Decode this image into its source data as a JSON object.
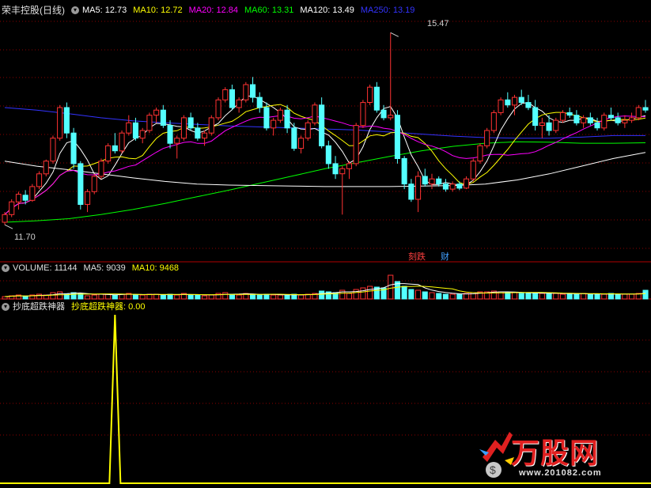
{
  "price_panel": {
    "stock_name": "荣丰控股(日线)",
    "ma_labels": [
      {
        "text": "MA5: 12.73",
        "color": "#ffffff"
      },
      {
        "text": "MA10: 12.72",
        "color": "#ffff00"
      },
      {
        "text": "MA20: 12.84",
        "color": "#ff00ff"
      },
      {
        "text": "MA60: 13.31",
        "color": "#00ff00"
      },
      {
        "text": "MA120: 13.49",
        "color": "#ffffff"
      },
      {
        "text": "MA250: 13.19",
        "color": "#3333ff"
      }
    ],
    "high_label": "15.47",
    "low_label": "11.70",
    "event_tags": [
      {
        "text": "刻跌",
        "color": "#ff4040"
      },
      {
        "text": "财",
        "color": "#40a0ff"
      }
    ]
  },
  "volume_panel": {
    "title": "VOLUME: 11144",
    "ma5": "MA5: 9039",
    "ma10": "MA10: 9468"
  },
  "indicator_panel": {
    "name": "抄底超跌神器",
    "value_label": "抄底超跌神器: 0.00"
  },
  "watermark": {
    "brand": "万股网",
    "url": "www.201082.com"
  },
  "colors": {
    "up": "#ff3232",
    "down": "#54ffff",
    "grid": "#8b0000",
    "ma5": "#ffffff",
    "ma10": "#ffff00",
    "ma20": "#ff00ff",
    "ma60": "#00ff00",
    "ma120": "#ffffff",
    "ma250": "#3333ff",
    "indicator": "#ffff00"
  },
  "chart_data": [
    {
      "type": "candlestick",
      "title": "荣丰控股(日线)",
      "y_range": [
        11.3,
        15.8
      ],
      "annotations": {
        "max": 15.47,
        "min": 11.7
      },
      "candles": [
        [
          11.75,
          11.95,
          11.7,
          11.9
        ],
        [
          11.9,
          12.2,
          11.85,
          12.15
        ],
        [
          12.15,
          12.35,
          12.0,
          12.3
        ],
        [
          12.28,
          12.38,
          12.1,
          12.18
        ],
        [
          12.18,
          12.5,
          12.15,
          12.45
        ],
        [
          12.45,
          12.75,
          12.4,
          12.7
        ],
        [
          12.7,
          12.98,
          12.65,
          12.95
        ],
        [
          12.95,
          13.45,
          12.9,
          13.4
        ],
        [
          13.4,
          14.05,
          13.35,
          14.0
        ],
        [
          14.0,
          14.1,
          13.4,
          13.5
        ],
        [
          13.5,
          13.6,
          12.8,
          12.9
        ],
        [
          12.9,
          12.95,
          12.0,
          12.1
        ],
        [
          12.1,
          12.4,
          11.95,
          12.35
        ],
        [
          12.35,
          12.7,
          12.3,
          12.65
        ],
        [
          12.65,
          13.0,
          12.6,
          12.95
        ],
        [
          12.95,
          13.3,
          12.9,
          13.25
        ],
        [
          13.25,
          13.5,
          13.1,
          13.15
        ],
        [
          13.15,
          13.55,
          13.1,
          13.5
        ],
        [
          13.5,
          13.85,
          13.45,
          13.7
        ],
        [
          13.7,
          13.8,
          13.35,
          13.4
        ],
        [
          13.4,
          13.6,
          13.3,
          13.55
        ],
        [
          13.55,
          13.9,
          13.5,
          13.85
        ],
        [
          13.85,
          14.0,
          13.7,
          13.95
        ],
        [
          13.95,
          14.05,
          13.6,
          13.65
        ],
        [
          13.65,
          13.75,
          13.2,
          13.3
        ],
        [
          13.3,
          13.45,
          13.0,
          13.4
        ],
        [
          13.4,
          13.85,
          13.35,
          13.8
        ],
        [
          13.8,
          13.9,
          13.55,
          13.6
        ],
        [
          13.6,
          13.7,
          13.35,
          13.4
        ],
        [
          13.4,
          13.55,
          13.25,
          13.5
        ],
        [
          13.5,
          13.85,
          13.45,
          13.8
        ],
        [
          13.8,
          14.2,
          13.75,
          14.15
        ],
        [
          14.15,
          14.4,
          14.1,
          14.35
        ],
        [
          14.35,
          14.45,
          13.95,
          14.0
        ],
        [
          14.0,
          14.2,
          13.9,
          14.15
        ],
        [
          14.15,
          14.5,
          14.1,
          14.45
        ],
        [
          14.45,
          14.6,
          14.1,
          14.2
        ],
        [
          14.2,
          14.3,
          13.9,
          14.0
        ],
        [
          14.0,
          14.1,
          13.55,
          13.6
        ],
        [
          13.6,
          13.8,
          13.45,
          13.75
        ],
        [
          13.75,
          14.0,
          13.7,
          13.95
        ],
        [
          13.95,
          14.05,
          13.5,
          13.6
        ],
        [
          13.6,
          13.7,
          13.15,
          13.2
        ],
        [
          13.2,
          13.45,
          13.1,
          13.4
        ],
        [
          13.4,
          13.75,
          13.35,
          13.7
        ],
        [
          13.7,
          14.1,
          13.65,
          14.05
        ],
        [
          14.05,
          14.2,
          13.2,
          13.25
        ],
        [
          13.25,
          13.35,
          12.8,
          12.9
        ],
        [
          12.9,
          13.05,
          12.6,
          12.7
        ],
        [
          12.7,
          12.85,
          11.9,
          12.8
        ],
        [
          12.8,
          12.95,
          12.6,
          12.9
        ],
        [
          12.9,
          13.7,
          12.85,
          13.65
        ],
        [
          13.65,
          14.15,
          13.6,
          14.1
        ],
        [
          14.1,
          14.45,
          14.05,
          14.4
        ],
        [
          14.4,
          14.5,
          13.9,
          13.95
        ],
        [
          13.95,
          14.05,
          13.75,
          13.8
        ],
        [
          13.8,
          15.47,
          13.75,
          13.85
        ],
        [
          13.85,
          13.95,
          12.9,
          13.0
        ],
        [
          13.0,
          13.05,
          12.4,
          12.5
        ],
        [
          12.5,
          12.6,
          12.15,
          12.2
        ],
        [
          12.2,
          12.75,
          11.95,
          12.65
        ],
        [
          12.65,
          12.8,
          12.45,
          12.5
        ],
        [
          12.5,
          12.7,
          12.4,
          12.6
        ],
        [
          12.6,
          12.65,
          12.45,
          12.5
        ],
        [
          12.5,
          12.6,
          12.35,
          12.4
        ],
        [
          12.4,
          12.55,
          12.35,
          12.5
        ],
        [
          12.5,
          12.55,
          12.38,
          12.42
        ],
        [
          12.42,
          12.65,
          12.4,
          12.6
        ],
        [
          12.6,
          13.0,
          12.55,
          12.95
        ],
        [
          12.95,
          13.3,
          12.9,
          13.25
        ],
        [
          13.25,
          13.6,
          13.2,
          13.55
        ],
        [
          13.55,
          13.95,
          13.5,
          13.9
        ],
        [
          13.9,
          14.2,
          13.85,
          14.15
        ],
        [
          14.15,
          14.3,
          14.0,
          14.05
        ],
        [
          14.05,
          14.25,
          13.85,
          14.2
        ],
        [
          14.2,
          14.35,
          14.05,
          14.1
        ],
        [
          14.1,
          14.25,
          13.95,
          14.0
        ],
        [
          14.0,
          14.15,
          13.55,
          13.65
        ],
        [
          13.65,
          13.8,
          13.4,
          13.7
        ],
        [
          13.7,
          13.85,
          13.45,
          13.55
        ],
        [
          13.55,
          13.8,
          13.5,
          13.75
        ],
        [
          13.75,
          13.95,
          13.7,
          13.9
        ],
        [
          13.9,
          14.0,
          13.8,
          13.85
        ],
        [
          13.85,
          13.95,
          13.65,
          13.7
        ],
        [
          13.7,
          13.85,
          13.6,
          13.8
        ],
        [
          13.8,
          13.9,
          13.65,
          13.7
        ],
        [
          13.7,
          13.8,
          13.55,
          13.6
        ],
        [
          13.6,
          13.9,
          13.55,
          13.85
        ],
        [
          13.85,
          14.0,
          13.75,
          13.8
        ],
        [
          13.8,
          13.9,
          13.65,
          13.7
        ],
        [
          13.7,
          13.85,
          13.6,
          13.75
        ],
        [
          13.75,
          13.9,
          13.7,
          13.8
        ],
        [
          13.8,
          14.05,
          13.75,
          14.0
        ],
        [
          14.0,
          14.15,
          13.9,
          13.95
        ]
      ],
      "ma_last": {
        "MA5": 12.73,
        "MA10": 12.72,
        "MA20": 12.84,
        "MA60": 13.31,
        "MA120": 13.49,
        "MA250": 13.19
      },
      "long_ma": {
        "MA60": [
          11.75,
          11.78,
          11.82,
          11.9,
          12.0,
          12.12,
          12.25,
          12.38,
          12.52,
          12.66,
          12.8,
          12.92,
          13.04,
          13.15,
          13.24,
          13.3,
          13.33,
          13.32,
          13.3,
          13.3,
          13.31
        ],
        "MA120": [
          12.95,
          12.85,
          12.78,
          12.7,
          12.62,
          12.55,
          12.5,
          12.48,
          12.47,
          12.46,
          12.45,
          12.45,
          12.45,
          12.46,
          12.47,
          12.5,
          12.58,
          12.7,
          12.85,
          13.0,
          13.12
        ],
        "MA250": [
          14.0,
          13.95,
          13.88,
          13.8,
          13.74,
          13.7,
          13.67,
          13.64,
          13.62,
          13.6,
          13.58,
          13.56,
          13.52,
          13.48,
          13.44,
          13.41,
          13.4,
          13.4,
          13.42,
          13.45,
          13.45
        ]
      }
    },
    {
      "type": "bar",
      "title": "VOLUME: 11144",
      "series": [
        {
          "name": "VOLUME",
          "values": [
            3,
            4,
            5,
            3,
            5,
            6,
            5,
            8,
            9,
            6,
            8,
            7,
            4,
            5,
            6,
            6,
            5,
            6,
            7,
            5,
            5,
            6,
            6,
            5,
            6,
            5,
            7,
            5,
            5,
            4,
            5,
            7,
            8,
            6,
            5,
            7,
            6,
            5,
            6,
            5,
            5,
            5,
            6,
            5,
            6,
            7,
            10,
            9,
            8,
            11,
            7,
            12,
            14,
            16,
            15,
            14,
            30,
            22,
            16,
            12,
            11,
            9,
            8,
            7,
            6,
            6,
            6,
            7,
            8,
            9,
            9,
            10,
            9,
            8,
            8,
            7,
            7,
            8,
            7,
            7,
            7,
            6,
            7,
            6,
            7,
            6,
            6,
            6,
            7,
            6,
            6,
            6,
            7,
            11
          ]
        }
      ],
      "labels": {
        "MA5": 9039,
        "MA10": 9468
      }
    },
    {
      "type": "line",
      "title": "抄底超跌神器",
      "series": [
        {
          "name": "抄底超跌神器",
          "spike_index": 16,
          "spike_value": 1,
          "values_last": 0.0
        }
      ]
    }
  ]
}
